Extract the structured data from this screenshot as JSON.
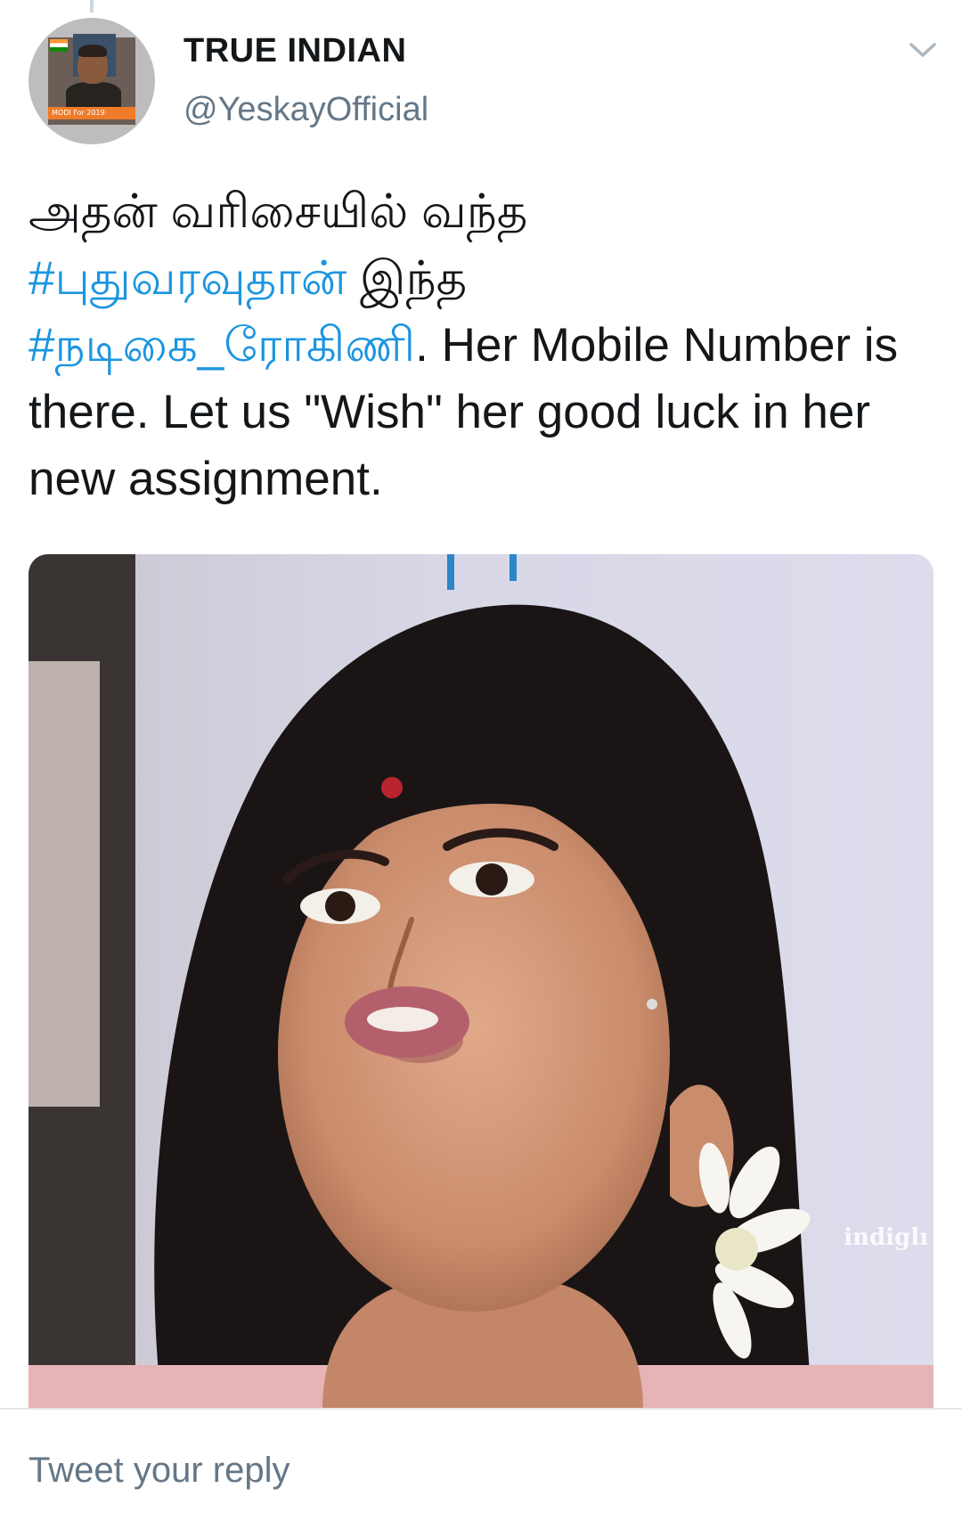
{
  "tweet": {
    "author_name": "TRUE INDIAN",
    "author_handle": "@YeskayOfficial",
    "avatar": {
      "banner_text": "MODI For 2019"
    },
    "text": {
      "line1": "அதன் வரிசையில் வந்த",
      "hashtag1": "#புதுவரவுதான்",
      "after_hashtag1": " இந்த",
      "hashtag2": "#நடிகை_ரோகிணி",
      "after_hashtag2": ". Her Mobile Number is there. Let us \"Wish\" her good luck in her new assignment."
    },
    "media": {
      "watermark": "indiglı"
    }
  },
  "reply": {
    "placeholder": "Tweet your reply"
  },
  "icons": {
    "menu": "chevron-down-icon"
  },
  "colors": {
    "hashtag": "#1b95e0",
    "handle": "#657786",
    "text": "#14171a",
    "divider": "#e1e8ed"
  }
}
